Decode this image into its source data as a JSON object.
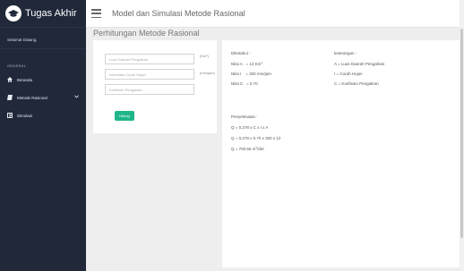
{
  "sidebar": {
    "brand_title": "Tugas Akhir",
    "greeting": "Selamat Datang,",
    "section_label": "GENERAL",
    "items": [
      {
        "label": "Beranda",
        "icon": "home-icon"
      },
      {
        "label": "Metode Rasional",
        "icon": "book-icon",
        "has_submenu": true
      },
      {
        "label": "Simulasi",
        "icon": "grid-icon"
      }
    ]
  },
  "header": {
    "title": "Model dan Simulasi Metode Rasional"
  },
  "page": {
    "title": "Perhitungan Metode Rasional"
  },
  "form": {
    "fields": [
      {
        "placeholder": "Luas Daerah Pengaliran",
        "value": "",
        "unit": "(Km²)"
      },
      {
        "placeholder": "Intensitas Curah Hujan",
        "value": "",
        "unit": "(mm/jam)"
      },
      {
        "placeholder": "Koefisien Pengaliran",
        "value": "",
        "unit": ""
      }
    ],
    "submit_label": "Hitung"
  },
  "results": {
    "diketahui_label": "Diketahui :",
    "diketahui": [
      {
        "name": "Nilai A",
        "value": "= 12 Km",
        "sup": "2"
      },
      {
        "name": "Nilai I",
        "value": "= 300 mm/jam",
        "sup": ""
      },
      {
        "name": "Nilai C",
        "value": "= 0.70",
        "sup": ""
      }
    ],
    "keterangan_label": "keterangan :",
    "keterangan": [
      "A = Luas Daerah Pengaliran",
      "I = Curah Hujan",
      "C = Koefisien Pengaliran"
    ],
    "penyelesaian_label": "Penyelesaian :",
    "steps": [
      {
        "text": "Q = 0,278 x C x I x A",
        "sup": "",
        "suffix": ""
      },
      {
        "text": "Q = 0,278 x 0.70 x 300 x 12",
        "sup": "",
        "suffix": ""
      },
      {
        "text": "Q = 700.56 m",
        "sup": "3",
        "suffix": "/det"
      }
    ]
  },
  "colors": {
    "sidebar_bg": "#20283a",
    "accent_button": "#21b58a",
    "page_bg": "#eeeeee"
  }
}
